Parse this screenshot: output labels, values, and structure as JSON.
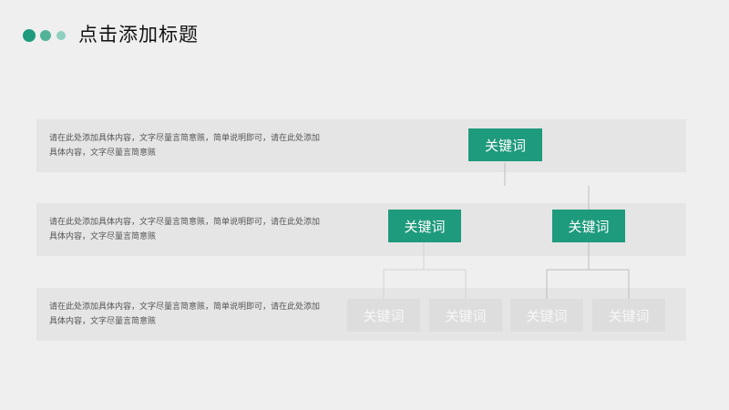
{
  "header": {
    "title": "点击添加标题"
  },
  "rows": [
    {
      "text": "请在此处添加具体内容，文字尽量言简意赅，简单说明即可，请在此处添加具体内容，文字尽量言简意赅"
    },
    {
      "text": "请在此处添加具体内容，文字尽量言简意赅，简单说明即可，请在此处添加具体内容，文字尽量言简意赅"
    },
    {
      "text": "请在此处添加具体内容，文字尽量言简意赅，简单说明即可，请在此处添加具体内容，文字尽量言简意赅"
    }
  ],
  "keywords": {
    "top": "关键词",
    "mid_left": "关键词",
    "mid_right": "关键词",
    "bottom": [
      "关键词",
      "关键词",
      "关键词",
      "关键词"
    ]
  },
  "colors": {
    "accent": "#1e9a7c",
    "accent_mid": "#52b39a",
    "accent_light": "#8fd0c0",
    "muted_box": "#dddddd",
    "row_band": "#e5e5e5",
    "background": "#efefef"
  }
}
